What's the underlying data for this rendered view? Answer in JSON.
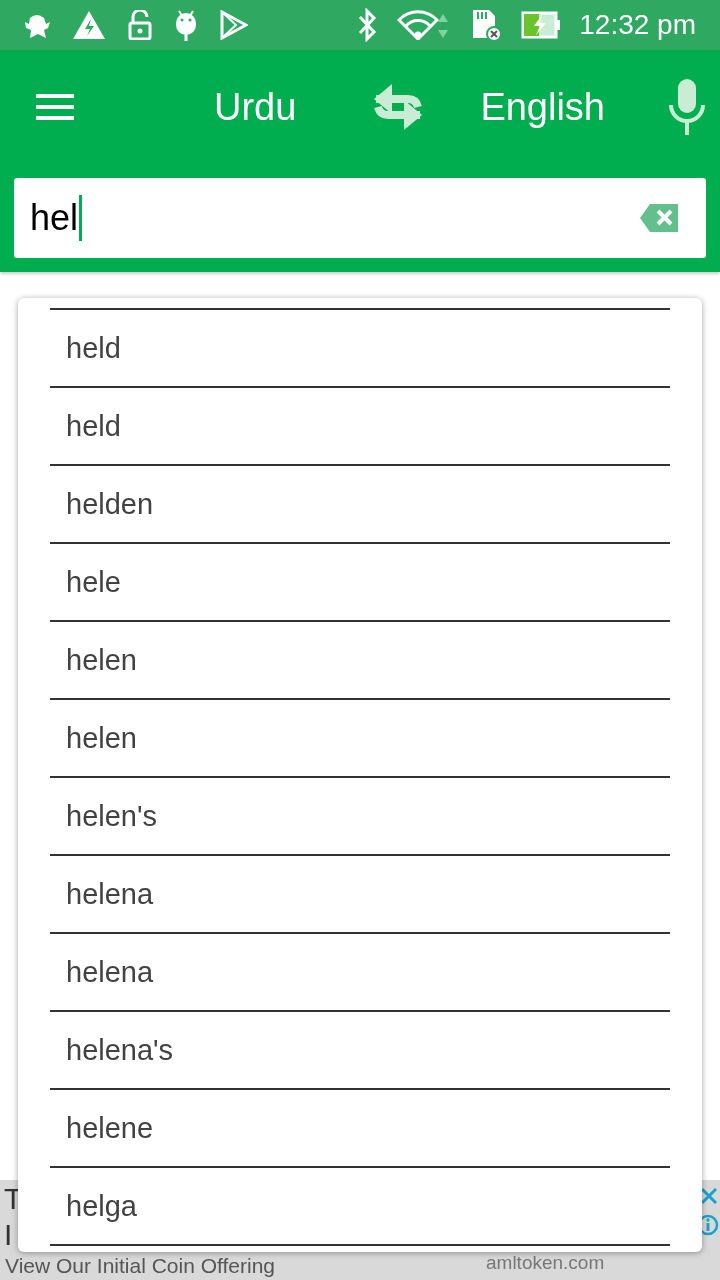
{
  "status_bar": {
    "time": "12:32 pm"
  },
  "app_bar": {
    "source_language": "Urdu",
    "target_language": "English"
  },
  "search": {
    "value": "hel"
  },
  "suggestions": [
    "held",
    "held",
    "helden",
    "hele",
    "helen",
    "helen",
    "helen's",
    "helena",
    "helena",
    "helena's",
    "helene",
    "helga"
  ],
  "ad": {
    "headline_lines": [
      "T",
      "I"
    ],
    "text": "View Our Initial Coin Offering",
    "domain": "amltoken.com"
  }
}
